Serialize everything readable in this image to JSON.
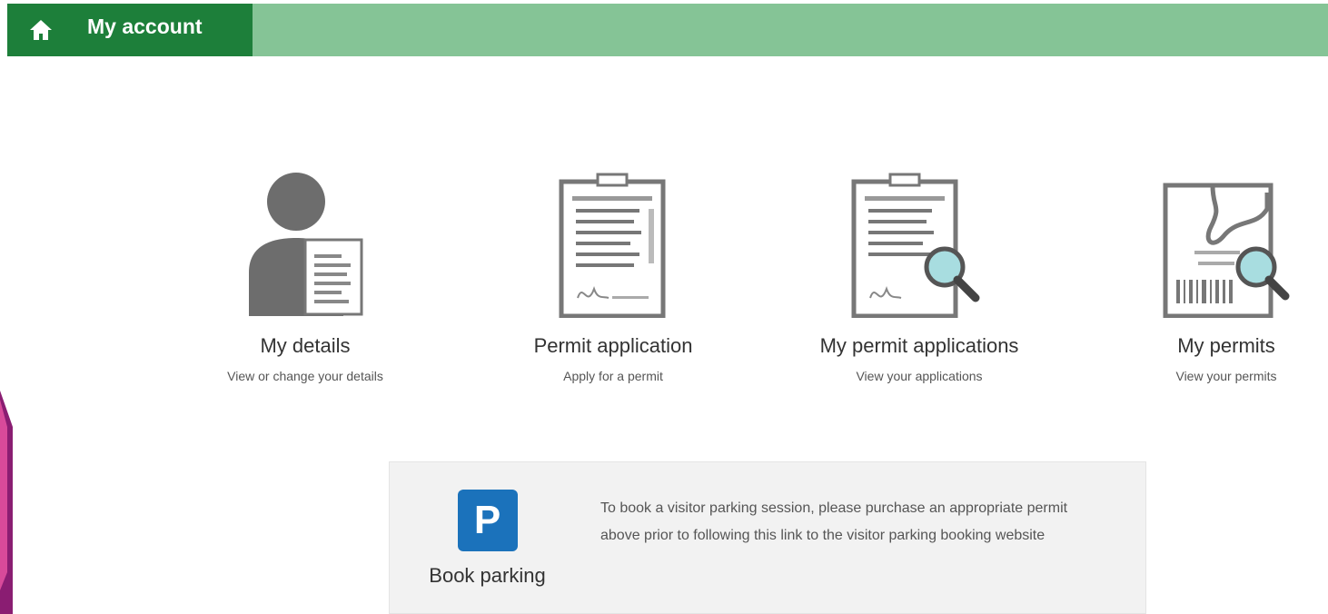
{
  "nav": {
    "home_icon": "home-icon",
    "title": "My account",
    "colors": {
      "bar": "#85c496",
      "tab": "#1d7f3a"
    }
  },
  "tiles": [
    {
      "icon": "user-details-icon",
      "title": "My details",
      "subtitle": "View or change your details"
    },
    {
      "icon": "clipboard-icon",
      "title": "Permit application",
      "subtitle": "Apply for a permit"
    },
    {
      "icon": "clipboard-search-icon",
      "title": "My permit applications",
      "subtitle": "View your applications"
    },
    {
      "icon": "permit-search-icon",
      "title": "My permits",
      "subtitle": "View your permits"
    }
  ],
  "parking": {
    "icon": "parking-icon",
    "badge": "P",
    "label": "Book parking",
    "text": "To book a visitor parking session, please purchase an appropriate permit above prior to following this link to the visitor parking booking website",
    "badge_color": "#1b72bb"
  }
}
